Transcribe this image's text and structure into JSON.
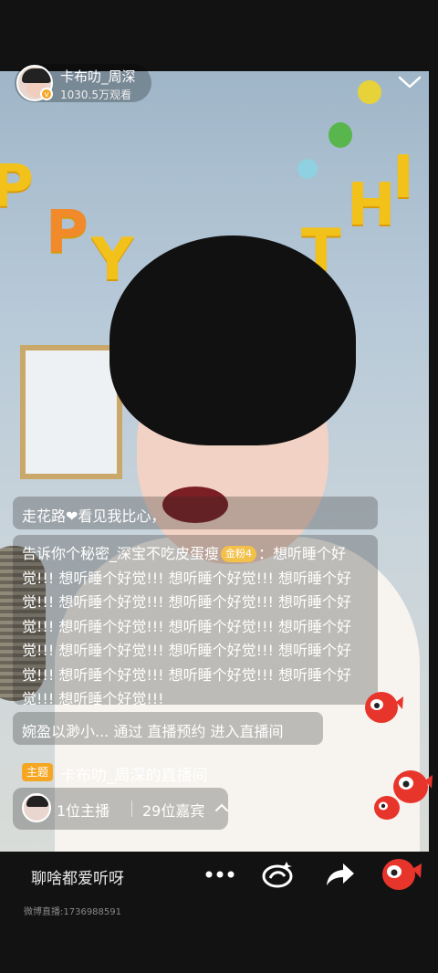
{
  "host": {
    "name": "卡布叻_周深",
    "views": "1030.5万观看"
  },
  "comments": [
    {
      "text": "走花路❤看见我比心，"
    },
    {
      "user": "告诉你个秘密_深宝不吃皮蛋瘦",
      "badge": "金粉4",
      "text": "：想听睡个好觉!!! 想听睡个好觉!!! 想听睡个好觉!!! 想听睡个好觉!!! 想听睡个好觉!!! 想听睡个好觉!!! 想听睡个好觉!!! 想听睡个好觉!!! 想听睡个好觉!!! 想听睡个好觉!!! 想听睡个好觉!!! 想听睡个好觉!!! 想听睡个好觉!!! 想听睡个好觉!!! 想听睡个好觉!!! 想听睡个好觉!!! 想听睡个好觉!!!"
    },
    {
      "text": "婉盈以渺小... 通过 直播预约 进入直播间"
    }
  ],
  "topic": {
    "tag": "主题",
    "title": "卡布叻_周深的直播间"
  },
  "participants": {
    "hosts": "1位主播",
    "guests": "29位嘉宾"
  },
  "bottom": {
    "placeholder": "聊啥都爱听呀",
    "footer_id": "微博直播:1736988591"
  },
  "icons": [
    "verified-badge-icon",
    "chevron-down-icon",
    "more-icon",
    "share-repost-icon",
    "forward-icon",
    "weibo-fish-icon"
  ],
  "colors": {
    "accent": "#f5a623",
    "brand_red": "#e8352b",
    "background": "#121212"
  }
}
